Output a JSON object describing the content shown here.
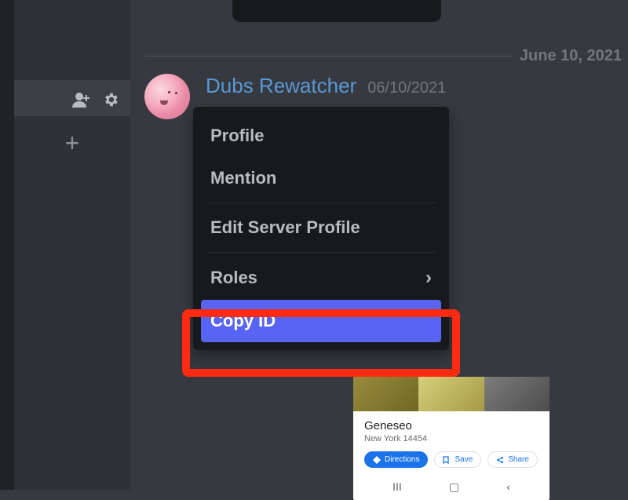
{
  "divider_date": "June 10, 2021",
  "sidebar": {
    "icons": {
      "add_user": "add-member-icon",
      "settings": "settings-icon",
      "plus": "+"
    }
  },
  "message": {
    "username": "Dubs Rewatcher",
    "timestamp": "06/10/2021"
  },
  "context_menu": {
    "profile": "Profile",
    "mention": "Mention",
    "edit_server_profile": "Edit Server Profile",
    "roles": "Roles",
    "copy_id": "Copy ID"
  },
  "embed": {
    "title": "Geneseo",
    "subtitle": "New York 14454",
    "chips": {
      "directions": "Directions",
      "save": "Save",
      "share": "Share"
    },
    "nav": {
      "recents": "III",
      "overview": "▢",
      "back": "‹"
    }
  }
}
